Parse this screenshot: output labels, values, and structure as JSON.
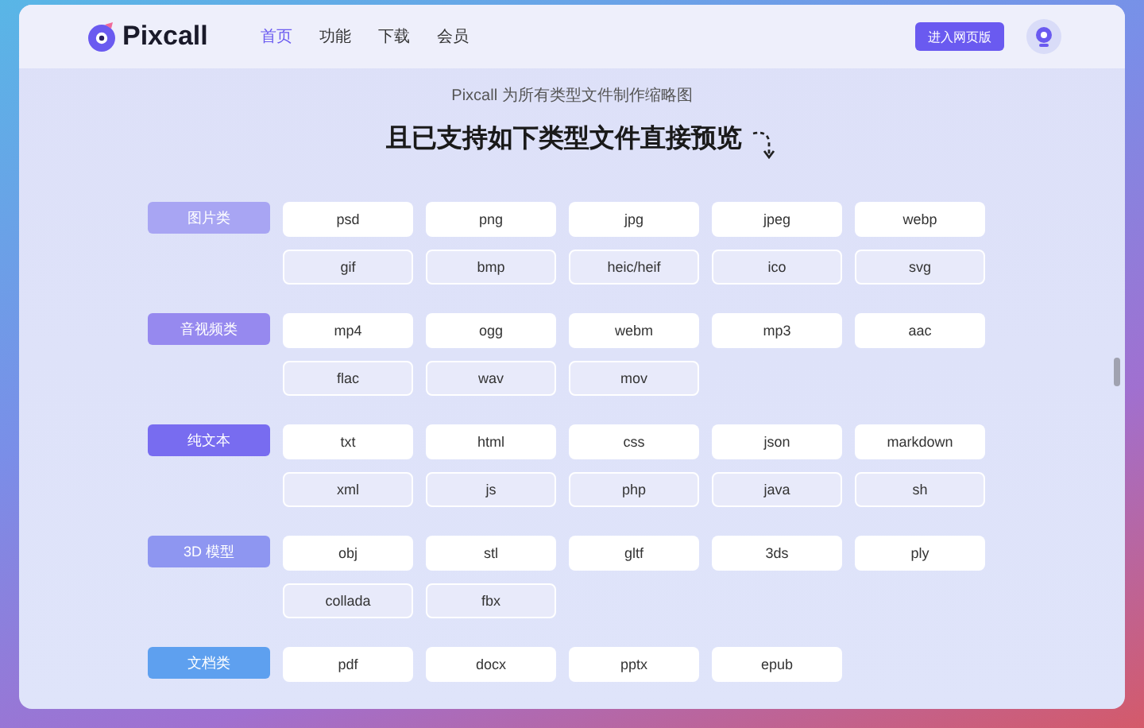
{
  "header": {
    "logo": "Pixcall",
    "nav": [
      {
        "label": "首页",
        "selected": true
      },
      {
        "label": "功能",
        "selected": false
      },
      {
        "label": "下载",
        "selected": false
      },
      {
        "label": "会员",
        "selected": false
      }
    ],
    "web_button": "进入网页版"
  },
  "subtitle": "Pixcall 为所有类型文件制作缩略图",
  "title": "且已支持如下类型文件直接预览",
  "groups": [
    {
      "label": "图片类",
      "color": "#a8a5f3",
      "formats": [
        "psd",
        "png",
        "jpg",
        "jpeg",
        "webp",
        "gif",
        "bmp",
        "heic/heif",
        "ico",
        "svg"
      ]
    },
    {
      "label": "音视频类",
      "color": "#9689ef",
      "formats": [
        "mp4",
        "ogg",
        "webm",
        "mp3",
        "aac",
        "flac",
        "wav",
        "mov"
      ]
    },
    {
      "label": "纯文本",
      "color": "#786cf0",
      "formats": [
        "txt",
        "html",
        "css",
        "json",
        "markdown",
        "xml",
        "js",
        "php",
        "java",
        "sh"
      ]
    },
    {
      "label": "3D 模型",
      "color": "#8e96f1",
      "formats": [
        "obj",
        "stl",
        "gltf",
        "3ds",
        "ply",
        "collada",
        "fbx"
      ]
    },
    {
      "label": "文档类",
      "color": "#5ea0ef",
      "formats": [
        "pdf",
        "docx",
        "pptx",
        "epub"
      ]
    }
  ]
}
